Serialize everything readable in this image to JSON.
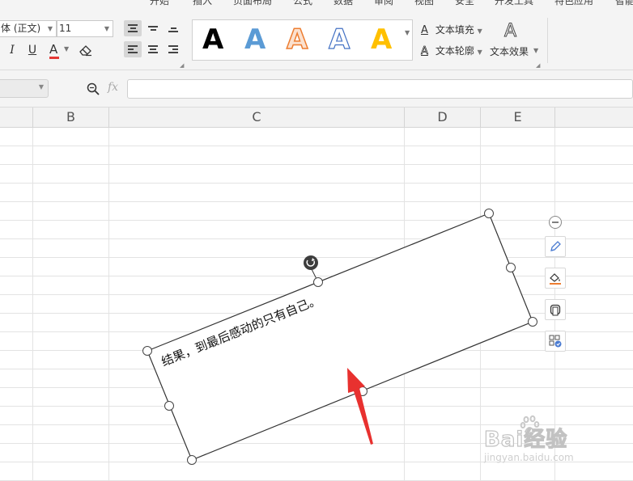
{
  "ribbon": {
    "tabs": [
      "开始",
      "插入",
      "页面布局",
      "公式",
      "数据",
      "审阅",
      "视图",
      "安全",
      "开发工具",
      "特色应用",
      "智能"
    ],
    "font_name": "体 (正文)",
    "font_size": "11",
    "format_buttons": {
      "italic": "I",
      "underline": "U",
      "font_color": "A"
    },
    "font_color_accent": "#e53935",
    "text_fill_label": "文本填充",
    "text_outline_label": "文本轮廓",
    "text_effect_label": "文本效果",
    "style_gallery_glyph": "A",
    "style_colors": [
      "#000000",
      "#5b9bd5",
      "#ed7d31",
      "#4472c4",
      "#ffc000"
    ]
  },
  "formula_bar": {
    "fx_label": "fx",
    "value": ""
  },
  "columns": [
    "B",
    "C",
    "D",
    "E"
  ],
  "textbox": {
    "text": "结果，到最后感动的只有自己。"
  },
  "floating_tools": [
    "collapse-icon",
    "pen-icon",
    "fill-icon",
    "frame-icon",
    "layout-icon"
  ],
  "watermark": {
    "brand": "Bai经验",
    "url": "jingyan.baidu.com"
  }
}
